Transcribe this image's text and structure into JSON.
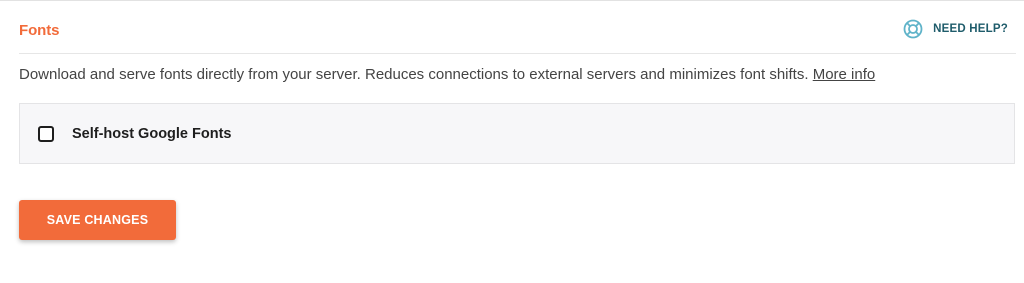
{
  "section": {
    "title": "Fonts",
    "help_label": "NEED HELP?",
    "help_icon": "lifebuoy-icon",
    "description": "Download and serve fonts directly from your server. Reduces connections to external servers and minimizes font shifts.",
    "more_info_label": "More info"
  },
  "options": {
    "self_host": {
      "label": "Self-host Google Fonts",
      "checked": false
    }
  },
  "actions": {
    "save_label": "SAVE CHANGES"
  },
  "colors": {
    "accent": "#f26b3a",
    "help_text": "#1f5c6b",
    "help_icon": "#5fb3c9"
  }
}
